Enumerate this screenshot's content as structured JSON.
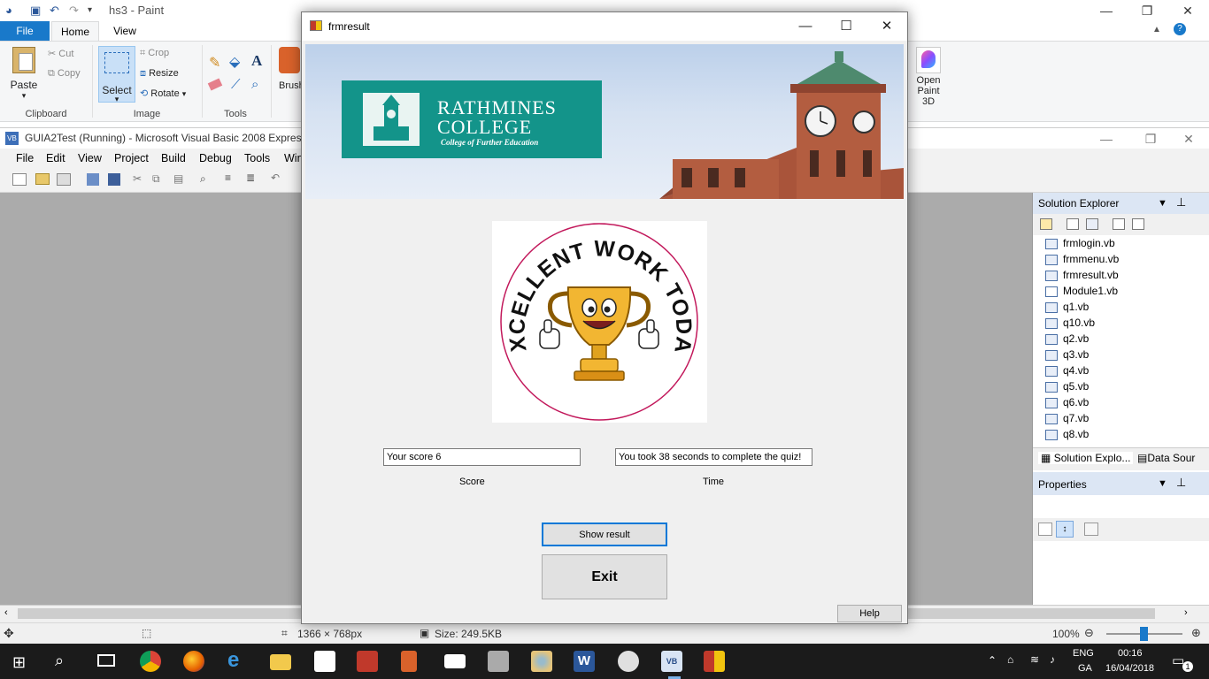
{
  "paint": {
    "title": "hs3 - Paint",
    "tabs": [
      "File",
      "Home",
      "View"
    ],
    "clipboard": {
      "paste": "Paste",
      "cut": "Cut",
      "copy": "Copy",
      "label": "Clipboard"
    },
    "image": {
      "select": "Select",
      "crop": "Crop",
      "resize": "Resize",
      "rotate": "Rotate",
      "label": "Image"
    },
    "tools": {
      "label": "Tools",
      "text_tool": "A"
    },
    "brushes": "Brush",
    "open_3d": [
      "Open",
      "Paint 3D"
    ],
    "status": {
      "dimensions": "1366 × 768px",
      "size": "Size: 249.5KB",
      "zoom": "100%"
    }
  },
  "vb": {
    "title": "GUIA2Test (Running) - Microsoft Visual Basic 2008 Express E",
    "menu": [
      "File",
      "Edit",
      "View",
      "Project",
      "Build",
      "Debug",
      "Tools",
      "Win"
    ],
    "solution_explorer": {
      "title": "Solution Explorer",
      "items": [
        "frmlogin.vb",
        "frmmenu.vb",
        "frmresult.vb",
        "Module1.vb",
        "q1.vb",
        "q10.vb",
        "q2.vb",
        "q3.vb",
        "q4.vb",
        "q5.vb",
        "q6.vb",
        "q7.vb",
        "q8.vb"
      ],
      "tabs": [
        "Solution Explo...",
        "Data Sour"
      ]
    },
    "properties": {
      "title": "Properties"
    }
  },
  "form": {
    "title": "frmresult",
    "logo": {
      "line1": "RATHMINES",
      "line2": "COLLEGE",
      "line3": "College of Further Education"
    },
    "badge_text": "EXCELLENT WORK TODAY",
    "score_value": "Your score 6",
    "score_label": "Score",
    "time_value": "You took 38 seconds to complete the quiz!",
    "time_label": "Time",
    "show_result": "Show result",
    "exit": "Exit",
    "help": "Help"
  },
  "taskbar": {
    "lang": [
      "ENG",
      "GA"
    ],
    "time": "00:16",
    "date": "16/04/2018",
    "notification_count": "1"
  },
  "colors": {
    "accent": "#1979ca",
    "logo_teal": "#13948a",
    "badge_ring": "#c2185b"
  }
}
